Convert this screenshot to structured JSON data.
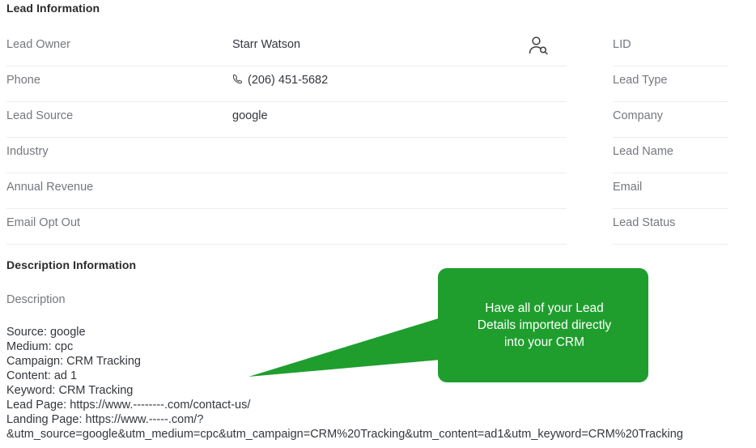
{
  "theme": {
    "accent_green": "#1f9e2e",
    "label_gray": "#74787e",
    "value_dark": "#33373c",
    "divider": "#ebecf0",
    "callout_text": "#ffffff"
  },
  "sections": {
    "lead_information": {
      "heading": "Lead Information",
      "left_fields": [
        {
          "label": "Lead Owner",
          "value": "Starr Watson",
          "icon": "",
          "has_lookup_icon": true
        },
        {
          "label": "Phone",
          "value": "(206) 451-5682",
          "icon": "phone-icon",
          "has_lookup_icon": false
        },
        {
          "label": "Lead Source",
          "value": "google",
          "icon": "",
          "has_lookup_icon": false
        },
        {
          "label": "Industry",
          "value": "",
          "icon": "",
          "has_lookup_icon": false
        },
        {
          "label": "Annual Revenue",
          "value": "",
          "icon": "",
          "has_lookup_icon": false
        },
        {
          "label": "Email Opt Out",
          "value": "",
          "icon": "",
          "has_lookup_icon": false
        }
      ],
      "right_fields": [
        {
          "label": "LID",
          "value": ""
        },
        {
          "label": "Lead Type",
          "value": ""
        },
        {
          "label": "Company",
          "value": ""
        },
        {
          "label": "Lead Name",
          "value": ""
        },
        {
          "label": "Email",
          "value": ""
        },
        {
          "label": "Lead Status",
          "value": ""
        }
      ]
    },
    "description_information": {
      "heading": "Description Information",
      "field_label": "Description",
      "body": "Source: google\nMedium: cpc\nCampaign: CRM Tracking\nContent: ad 1\nKeyword: CRM Tracking\nLead Page: https://www.--------.com/contact-us/\nLanding Page: https://www.-----.com/?\n&utm_source=google&utm_medium=cpc&utm_campaign=CRM%20Tracking&utm_content=ad1&utm_keyword=CRM%20Tracking"
    }
  },
  "callout": {
    "text": "Have all of your Lead\nDetails imported directly\ninto your CRM",
    "color": "#1f9e2e"
  },
  "icons": {
    "phone": "phone-icon",
    "lookup_user": "person-search-icon"
  }
}
